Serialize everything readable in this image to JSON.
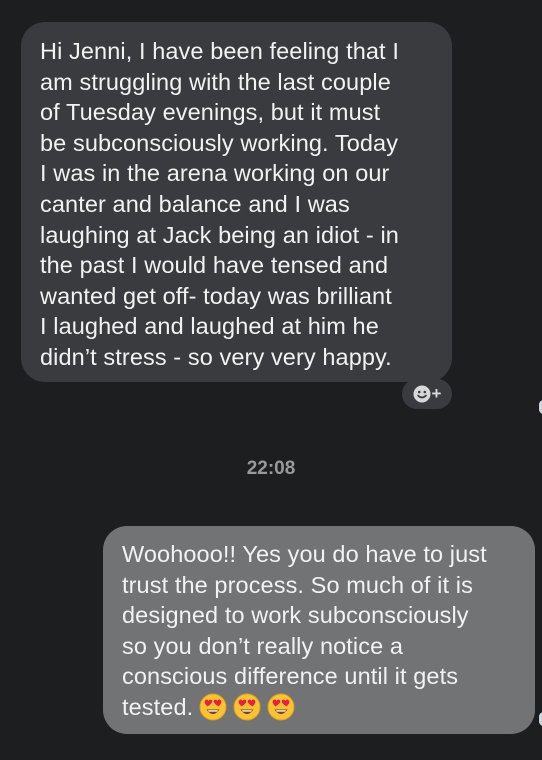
{
  "conversation": {
    "incoming": {
      "lines": [
        "Hi Jenni, I have been feeling that I",
        "am struggling with the last couple",
        "of Tuesday evenings, but it must",
        "be subconsciously working. Today",
        "I was in the arena working on our",
        "canter and balance and I was",
        "laughing at Jack being an idiot - in",
        "the past I would have tensed and",
        "wanted get off- today was brilliant",
        "I laughed and laughed at him he",
        "didn’t stress - so very very happy."
      ]
    },
    "reaction_button": {
      "icon": "smiley-add-icon",
      "plus": "+"
    },
    "timestamp": "22:08",
    "outgoing": {
      "lines": [
        "Woohooo!! Yes you do have to just",
        "trust the process. So much of it is",
        "designed to work subconsciously",
        "so you don’t really notice a",
        "conscious difference until it gets",
        "tested."
      ],
      "emojis": [
        "heart-eyes-emoji",
        "heart-eyes-emoji",
        "heart-eyes-emoji"
      ]
    }
  },
  "colors": {
    "background": "#1d1e20",
    "incoming_bubble": "#3a3b3e",
    "outgoing_bubble": "#727375",
    "text": "#f2f2f3",
    "timestamp": "#98999c"
  }
}
